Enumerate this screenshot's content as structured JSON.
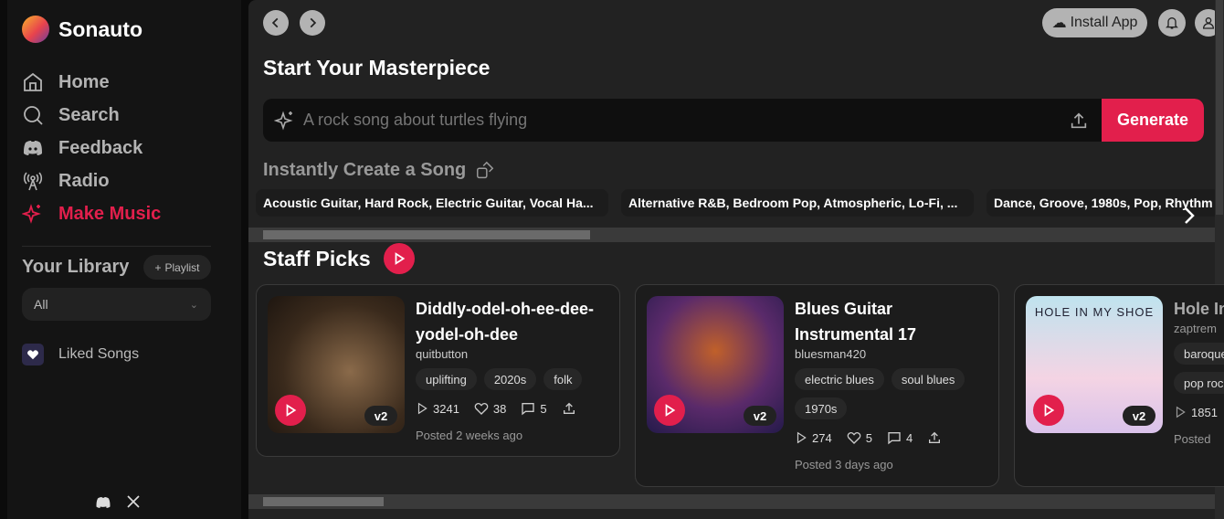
{
  "app": {
    "name": "Sonauto"
  },
  "sidebar": {
    "items": [
      {
        "label": "Home",
        "icon": "home-icon"
      },
      {
        "label": "Search",
        "icon": "search-icon"
      },
      {
        "label": "Feedback",
        "icon": "discord-icon"
      },
      {
        "label": "Radio",
        "icon": "radio-icon"
      },
      {
        "label": "Make Music",
        "icon": "sparkle-icon",
        "active": true
      }
    ],
    "library_title": "Your Library",
    "playlist_label": "Playlist",
    "filter_value": "All",
    "liked_songs": "Liked Songs"
  },
  "header": {
    "install_label": "Install App"
  },
  "composer": {
    "title": "Start Your Masterpiece",
    "placeholder": "A rock song about turtles flying",
    "generate_label": "Generate"
  },
  "instant": {
    "title": "Instantly Create a Song",
    "chips": [
      "Acoustic Guitar, Hard Rock, Electric Guitar, Vocal Ha...",
      "Alternative R&B, Bedroom Pop, Atmospheric, Lo-Fi, ...",
      "Dance, Groove, 1980s, Pop, Rhythm"
    ]
  },
  "staff_picks": {
    "title": "Staff Picks",
    "cards": [
      {
        "title": "Diddly-odel-oh-ee-dee-yodel-oh-dee",
        "author": "quitbutton",
        "tags": [
          "uplifting",
          "2020s",
          "folk"
        ],
        "plays": "3241",
        "likes": "38",
        "comments": "5",
        "posted": "Posted 2 weeks ago",
        "version": "v2"
      },
      {
        "title": "Blues Guitar Instrumental 17",
        "author": "bluesman420",
        "tags": [
          "electric blues",
          "soul blues",
          "1970s"
        ],
        "plays": "274",
        "likes": "5",
        "comments": "4",
        "posted": "Posted 3 days ago",
        "version": "v2"
      },
      {
        "title": "Hole In My Shoe Demo",
        "author": "zaptrem",
        "tags": [
          "baroque",
          "pop rock"
        ],
        "plays": "1851",
        "likes": "",
        "comments": "",
        "posted": "Posted",
        "version": "v2",
        "art_text": "HOLE IN MY SHOE"
      }
    ]
  },
  "colors": {
    "accent": "#e21f4c",
    "background": "#222222",
    "sidebar": "#141414"
  }
}
